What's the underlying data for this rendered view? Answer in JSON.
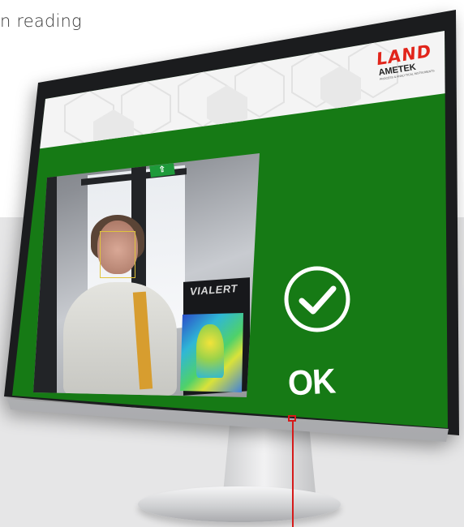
{
  "page": {
    "caption": "n reading"
  },
  "screen": {
    "background_color": "#167a15",
    "logo": {
      "brand": "LAND",
      "parent": "AMETEK",
      "tagline": "PROCESS & ANALYTICAL INSTRUMENTS"
    },
    "camera_feed": {
      "exit_sign": "⇧",
      "kiosk_label": "VIALERT"
    },
    "status": {
      "result_label": "OK",
      "result_color": "#ffffff",
      "icon": "check-circle-icon"
    }
  },
  "accent_color": "#d61a1a"
}
